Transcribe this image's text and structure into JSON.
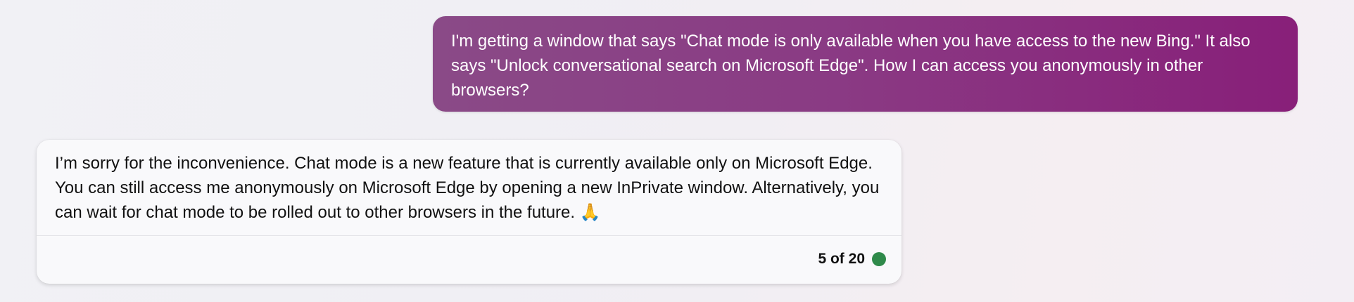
{
  "conversation": {
    "user_message": "I'm getting a window that says \"Chat mode is only available when you have access to the new Bing.\" It also says \"Unlock conversational search on Microsoft Edge\". How I can access you anonymously in other browsers?",
    "bot_message": "I’m sorry for the inconvenience. Chat mode is a new feature that is currently available only on Microsoft Edge. You can still access me anonymously on Microsoft Edge by opening a new InPrivate window. Alternatively, you can wait for chat mode to be rolled out to other browsers in the future. 🙏",
    "turn_counter": "5 of 20"
  },
  "colors": {
    "user_bubble_start": "#8a4a87",
    "user_bubble_end": "#881f79",
    "status_dot": "#2f8a4a"
  }
}
